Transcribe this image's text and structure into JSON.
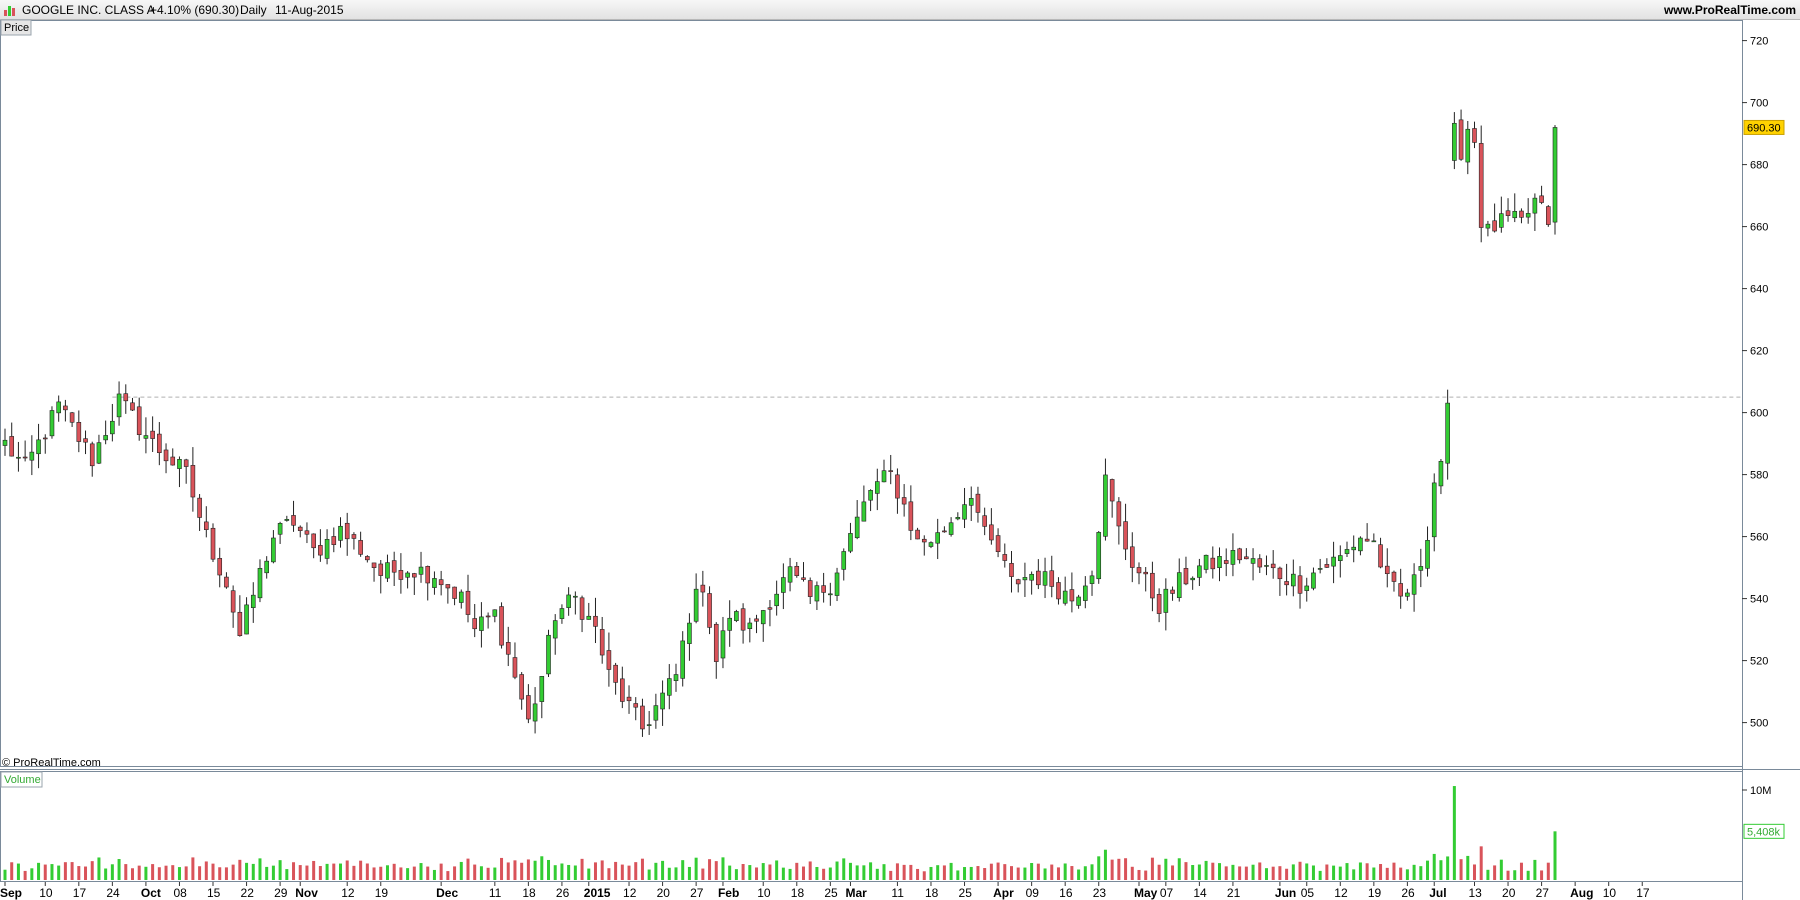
{
  "header": {
    "instrument": "GOOGLE INC. CLASS A",
    "change": "+4.10% (690.30)",
    "period": "Daily",
    "date": "11-Aug-2015",
    "site": "www.ProRealTime.com"
  },
  "price_panel": {
    "label": "Price",
    "copyright": "© ProRealTime.com"
  },
  "volume_panel": {
    "label": "Volume"
  },
  "colors": {
    "up": "#33cc33",
    "down": "#d9535a",
    "last_bg": "#ffd200",
    "grid": "#c8c8c8"
  },
  "chart_data": [
    {
      "type": "candlestick",
      "title": "GOOGLE INC. CLASS A",
      "ylim": [
        486,
        726
      ],
      "y_ticks": [
        500,
        520,
        540,
        560,
        580,
        600,
        620,
        640,
        660,
        680,
        700,
        720
      ],
      "last_price_label": "690.30",
      "reference_line": 605,
      "x_tick_labels": [
        {
          "i": 0,
          "label": "Sep",
          "bold": true
        },
        {
          "i": 6,
          "label": "10"
        },
        {
          "i": 11,
          "label": "17"
        },
        {
          "i": 16,
          "label": "24"
        },
        {
          "i": 21,
          "label": "Oct",
          "bold": true
        },
        {
          "i": 26,
          "label": "08"
        },
        {
          "i": 31,
          "label": "15"
        },
        {
          "i": 36,
          "label": "22"
        },
        {
          "i": 41,
          "label": "29"
        },
        {
          "i": 44,
          "label": "Nov",
          "bold": true
        },
        {
          "i": 51,
          "label": "12"
        },
        {
          "i": 56,
          "label": "19"
        },
        {
          "i": 65,
          "label": "Dec",
          "bold": true
        },
        {
          "i": 73,
          "label": "11"
        },
        {
          "i": 78,
          "label": "18"
        },
        {
          "i": 83,
          "label": "26"
        },
        {
          "i": 87,
          "label": "2015",
          "bold": true
        },
        {
          "i": 93,
          "label": "12"
        },
        {
          "i": 98,
          "label": "20"
        },
        {
          "i": 103,
          "label": "27"
        },
        {
          "i": 107,
          "label": "Feb",
          "bold": true
        },
        {
          "i": 113,
          "label": "10"
        },
        {
          "i": 118,
          "label": "18"
        },
        {
          "i": 123,
          "label": "25"
        },
        {
          "i": 126,
          "label": "Mar",
          "bold": true
        },
        {
          "i": 133,
          "label": "11"
        },
        {
          "i": 138,
          "label": "18"
        },
        {
          "i": 143,
          "label": "25"
        },
        {
          "i": 148,
          "label": "Apr",
          "bold": true
        },
        {
          "i": 153,
          "label": "09"
        },
        {
          "i": 158,
          "label": "16"
        },
        {
          "i": 163,
          "label": "23"
        },
        {
          "i": 169,
          "label": "May",
          "bold": true
        },
        {
          "i": 173,
          "label": "07"
        },
        {
          "i": 178,
          "label": "14"
        },
        {
          "i": 183,
          "label": "21"
        },
        {
          "i": 190,
          "label": "Jun",
          "bold": true
        },
        {
          "i": 194,
          "label": "05"
        },
        {
          "i": 199,
          "label": "12"
        },
        {
          "i": 204,
          "label": "19"
        },
        {
          "i": 209,
          "label": "26"
        },
        {
          "i": 213,
          "label": "Jul",
          "bold": true
        },
        {
          "i": 219,
          "label": "13"
        },
        {
          "i": 224,
          "label": "20"
        },
        {
          "i": 229,
          "label": "27"
        },
        {
          "i": 234,
          "label": "Aug",
          "bold": true
        },
        {
          "i": 239,
          "label": "10"
        },
        {
          "i": 244,
          "label": "17"
        }
      ],
      "waypoints": [
        [
          0,
          590
        ],
        [
          3,
          582
        ],
        [
          8,
          602
        ],
        [
          13,
          585
        ],
        [
          17,
          604
        ],
        [
          22,
          590
        ],
        [
          27,
          580
        ],
        [
          30,
          560
        ],
        [
          33,
          545
        ],
        [
          35,
          528
        ],
        [
          38,
          548
        ],
        [
          40,
          560
        ],
        [
          43,
          565
        ],
        [
          46,
          555
        ],
        [
          50,
          562
        ],
        [
          53,
          556
        ],
        [
          56,
          548
        ],
        [
          60,
          550
        ],
        [
          64,
          548
        ],
        [
          68,
          540
        ],
        [
          70,
          530
        ],
        [
          73,
          535
        ],
        [
          76,
          515
        ],
        [
          78,
          500
        ],
        [
          80,
          515
        ],
        [
          82,
          535
        ],
        [
          85,
          540
        ],
        [
          88,
          530
        ],
        [
          90,
          515
        ],
        [
          93,
          505
        ],
        [
          95,
          498
        ],
        [
          97,
          505
        ],
        [
          100,
          515
        ],
        [
          102,
          535
        ],
        [
          104,
          545
        ],
        [
          106,
          520
        ],
        [
          108,
          535
        ],
        [
          111,
          530
        ],
        [
          114,
          540
        ],
        [
          117,
          548
        ],
        [
          120,
          540
        ],
        [
          123,
          545
        ],
        [
          126,
          560
        ],
        [
          129,
          575
        ],
        [
          132,
          580
        ],
        [
          134,
          570
        ],
        [
          136,
          558
        ],
        [
          139,
          560
        ],
        [
          142,
          568
        ],
        [
          144,
          575
        ],
        [
          146,
          560
        ],
        [
          148,
          555
        ],
        [
          150,
          545
        ],
        [
          153,
          548
        ],
        [
          156,
          545
        ],
        [
          159,
          540
        ],
        [
          162,
          550
        ],
        [
          164,
          578
        ],
        [
          166,
          562
        ],
        [
          168,
          552
        ],
        [
          170,
          545
        ],
        [
          172,
          538
        ],
        [
          175,
          545
        ],
        [
          178,
          550
        ],
        [
          181,
          552
        ],
        [
          184,
          554
        ],
        [
          187,
          550
        ],
        [
          190,
          548
        ],
        [
          193,
          545
        ],
        [
          196,
          550
        ],
        [
          199,
          553
        ],
        [
          202,
          560
        ],
        [
          204,
          558
        ],
        [
          206,
          545
        ],
        [
          208,
          540
        ],
        [
          210,
          545
        ],
        [
          211,
          552
        ],
        [
          212,
          562
        ],
        [
          213,
          578
        ],
        [
          214,
          585
        ],
        [
          215,
          600
        ],
        [
          216,
          690
        ],
        [
          217,
          685
        ],
        [
          218,
          692
        ],
        [
          219,
          688
        ],
        [
          220,
          662
        ],
        [
          221,
          658
        ],
        [
          222,
          660
        ],
        [
          224,
          662
        ],
        [
          226,
          661
        ],
        [
          228,
          668
        ],
        [
          229,
          665
        ],
        [
          230,
          662
        ],
        [
          231,
          690
        ]
      ],
      "n_sessions": 232
    },
    {
      "type": "bar",
      "title": "Volume",
      "y_ticks": [
        10000000
      ],
      "y_tick_labels": [
        "10M"
      ],
      "ylim": [
        0,
        12000000
      ],
      "last_value_label": "5,408k",
      "last_value": 5408000,
      "base_volume": 1600000
    }
  ]
}
